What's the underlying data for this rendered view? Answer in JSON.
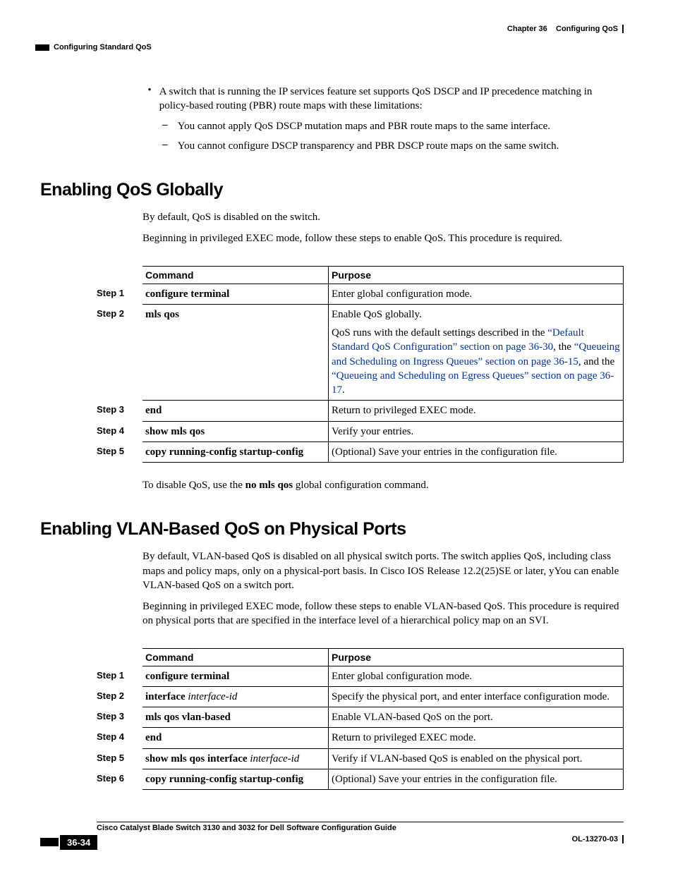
{
  "header": {
    "chapter": "Chapter 36",
    "chapter_title": "Configuring QoS",
    "section": "Configuring Standard QoS"
  },
  "intro_bullet": "A switch that is running the IP services feature set supports QoS DSCP and IP precedence matching in policy-based routing (PBR) route maps with these limitations:",
  "sub_bullet_1": "You cannot apply QoS DSCP mutation maps and PBR route maps to the same interface.",
  "sub_bullet_2": "You cannot configure DSCP transparency and PBR DSCP route maps on the same switch.",
  "h1": "Enabling QoS Globally",
  "h1_p1": "By default, QoS is disabled on the switch.",
  "h1_p2": "Beginning in privileged EXEC mode, follow these steps to enable QoS. This procedure is required.",
  "table_header": {
    "command": "Command",
    "purpose": "Purpose"
  },
  "t1": {
    "r1": {
      "step": "Step 1",
      "cmd": "configure terminal",
      "purpose": "Enter global configuration mode."
    },
    "r2": {
      "step": "Step 2",
      "cmd": "mls qos",
      "purpose_pre": "Enable QoS globally.",
      "p2a": "QoS runs with the default settings described in the ",
      "link1": "“Default Standard QoS Configuration” section on page 36-30",
      "p2b": ", the ",
      "link2": "“Queueing and Scheduling on Ingress Queues” section on page 36-15",
      "p2c": ", and the ",
      "link3": "“Queueing and Scheduling on Egress Queues” section on page 36-17",
      "p2d": "."
    },
    "r3": {
      "step": "Step 3",
      "cmd": "end",
      "purpose": "Return to privileged EXEC mode."
    },
    "r4": {
      "step": "Step 4",
      "cmd": "show mls qos",
      "purpose": "Verify your entries."
    },
    "r5": {
      "step": "Step 5",
      "cmd": "copy running-config startup-config",
      "purpose": "(Optional) Save your entries in the configuration file."
    }
  },
  "h1_after_pre": "To disable QoS, use the ",
  "h1_after_bold": "no mls qos",
  "h1_after_post": " global configuration command.",
  "h2": "Enabling VLAN-Based QoS on Physical Ports",
  "h2_p1": "By default, VLAN-based QoS is disabled on all physical switch ports. The switch applies QoS, including class maps and policy maps, only on a physical-port basis. In Cisco IOS Release 12.2(25)SE or later, yYou can enable VLAN-based QoS on a switch port.",
  "h2_p2": "Beginning in privileged EXEC mode, follow these steps to enable VLAN-based QoS. This procedure is required on physical ports that are specified in the interface level of a hierarchical policy map on an SVI.",
  "t2": {
    "r1": {
      "step": "Step 1",
      "cmd": "configure terminal",
      "purpose": "Enter global configuration mode."
    },
    "r2": {
      "step": "Step 2",
      "cmd_b": "interface ",
      "cmd_i": "interface-id",
      "purpose": "Specify the physical port, and enter interface configuration mode."
    },
    "r3": {
      "step": "Step 3",
      "cmd": "mls qos vlan-based",
      "purpose": "Enable VLAN-based QoS on the port."
    },
    "r4": {
      "step": "Step 4",
      "cmd": "end",
      "purpose": "Return to privileged EXEC mode."
    },
    "r5": {
      "step": "Step 5",
      "cmd_b": "show mls qos interface ",
      "cmd_i": "interface-id",
      "purpose": "Verify if VLAN-based QoS is enabled on the physical port."
    },
    "r6": {
      "step": "Step 6",
      "cmd": "copy running-config startup-config",
      "purpose": "(Optional) Save your entries in the configuration file."
    }
  },
  "footer": {
    "guide": "Cisco Catalyst Blade Switch 3130 and 3032 for Dell Software Configuration Guide",
    "page": "36-34",
    "doc": "OL-13270-03"
  }
}
